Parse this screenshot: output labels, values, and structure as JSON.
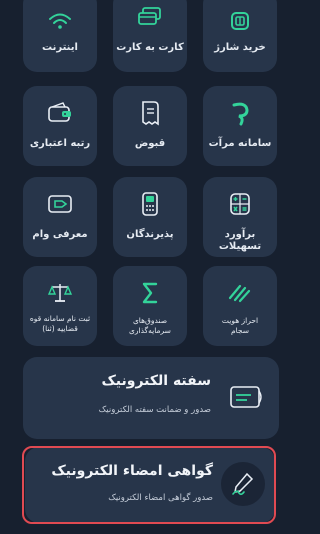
{
  "colors": {
    "background": "#17202f",
    "tile": "#27354a",
    "accent_green": "#33d39a",
    "highlight_red": "#e04a52"
  },
  "grid": {
    "row1": [
      {
        "label": "خرید شارژ",
        "icon": "sim-card-icon"
      },
      {
        "label": "کارت به کارت",
        "icon": "cards-icon"
      },
      {
        "label": "اینترنت",
        "icon": "wifi-icon"
      }
    ],
    "row2": [
      {
        "label": "سامانه مرآت",
        "icon": "meraat-logo-icon"
      },
      {
        "label": "قبوض",
        "icon": "receipt-icon"
      },
      {
        "label": "رتبه اعتباری",
        "icon": "wallet-icon"
      }
    ],
    "row3": [
      {
        "label": "برآورد تسهیلات",
        "icon": "calculator-icon"
      },
      {
        "label": "پذیرندگان",
        "icon": "pos-terminal-icon"
      },
      {
        "label": "معرفی وام",
        "icon": "loan-card-icon"
      }
    ],
    "row4": [
      {
        "label": "احراز هویت سجام",
        "icon": "sejam-icon"
      },
      {
        "label": "صندوق‌های سرمایه‌گذاری",
        "icon": "sigma-icon"
      },
      {
        "label": "ثبت نام سامانه قوه قضاییه (ثنا)",
        "icon": "scales-icon"
      }
    ]
  },
  "cards": {
    "safte": {
      "title": "سفته الکترونیک",
      "subtitle": "صدور و ضمانت سفته الکترونیک",
      "icon": "promissory-note-icon"
    },
    "signature": {
      "title": "گواهی امضاء الکترونیک",
      "subtitle": "صدور گواهی امضاء الکترونیک",
      "icon": "pen-signature-icon"
    }
  }
}
